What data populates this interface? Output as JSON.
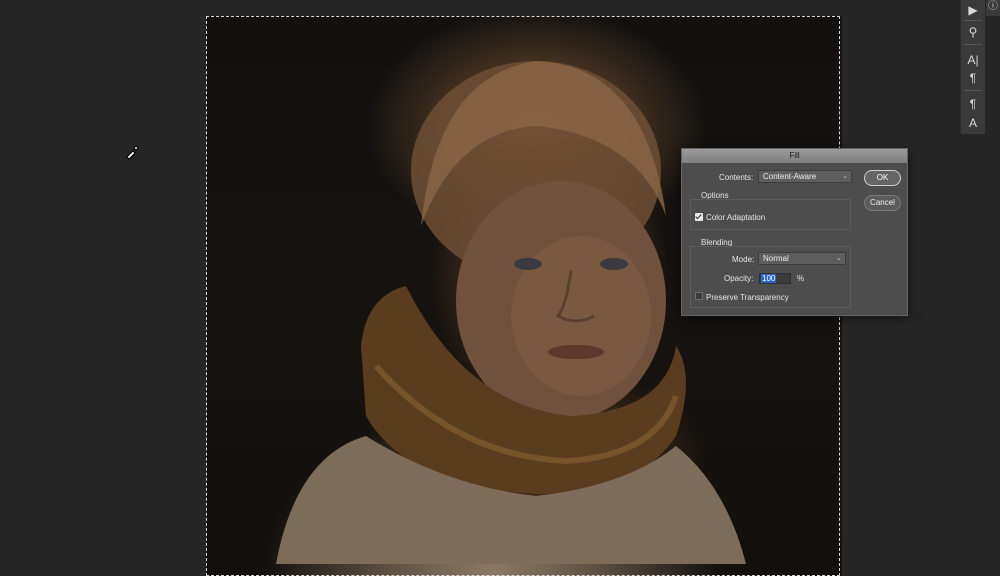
{
  "dialog": {
    "title": "Fill",
    "contents_label": "Contents:",
    "contents_value": "Content-Aware",
    "options_heading": "Options",
    "color_adaptation_label": "Color Adaptation",
    "color_adaptation_checked": true,
    "blending_heading": "Blending",
    "mode_label": "Mode:",
    "mode_value": "Normal",
    "opacity_label": "Opacity:",
    "opacity_value": "100",
    "opacity_unit": "%",
    "preserve_transparency_label": "Preserve Transparency",
    "preserve_transparency_checked": false,
    "ok_label": "OK",
    "cancel_label": "Cancel"
  },
  "toolstrip": {
    "icons": [
      "play-icon",
      "stamp-icon",
      "character-icon",
      "paragraph-icon",
      "paragraph-styles-icon",
      "character-styles-icon"
    ],
    "glyphs": [
      "▶",
      "⚲",
      "A|",
      "¶",
      "¶",
      "A"
    ]
  },
  "info_icon": {
    "name": "info-icon",
    "glyph": "ⓘ"
  },
  "cursor": {
    "name": "eyedropper-cursor-icon"
  },
  "colors": {
    "workspace_bg": "#262626",
    "dialog_bg": "#4d4d4d",
    "selection_highlight": "#2b63c9"
  }
}
